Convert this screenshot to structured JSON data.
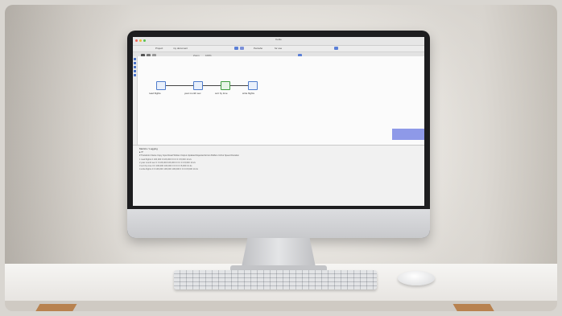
{
  "screen": {
    "window_title": "Kettle",
    "menubar": {
      "items": [
        "Project",
        "my document",
        "Pentaho",
        "for use"
      ]
    },
    "toolbar": {
      "items": [
        "Zoom",
        "100%"
      ]
    },
    "pipeline": {
      "steps": [
        {
          "label": "read flights"
        },
        {
          "label": "year month sec"
        },
        {
          "label": "sort by time"
        },
        {
          "label": "write flights"
        }
      ]
    },
    "log": {
      "tab_label": "Metrics / Logging",
      "sub_label": "▸ ⟳",
      "headers": [
        "# Transform Name",
        "Copy",
        "Input",
        "Read",
        "Written",
        "Output",
        "Updated",
        "Rejected",
        "Errors",
        "Buffers In/Out",
        "Speed",
        "Duration"
      ],
      "rows": [
        [
          "1 read flights",
          "0",
          "106,000",
          "0",
          "106,000",
          "0",
          "0",
          "0",
          "0",
          "0",
          "8,000",
          "13.2s"
        ],
        [
          "2 year month sec",
          "0",
          "0",
          "106,000",
          "106,000",
          "0",
          "0",
          "0",
          "0",
          "0",
          "8,000",
          "13.2s"
        ],
        [
          "3 sort by time",
          "0",
          "0",
          "106,000",
          "106,000",
          "0",
          "0",
          "0",
          "0",
          "0",
          "8,000",
          "13.2s"
        ],
        [
          "4 write flights",
          "0",
          "0",
          "106,000",
          "106,000",
          "106,000",
          "0",
          "0",
          "0",
          "0",
          "8,000",
          "13.2s"
        ]
      ]
    }
  },
  "colors": {
    "step_border": "#4f7ccc",
    "accent_block": "#8e99e8"
  }
}
